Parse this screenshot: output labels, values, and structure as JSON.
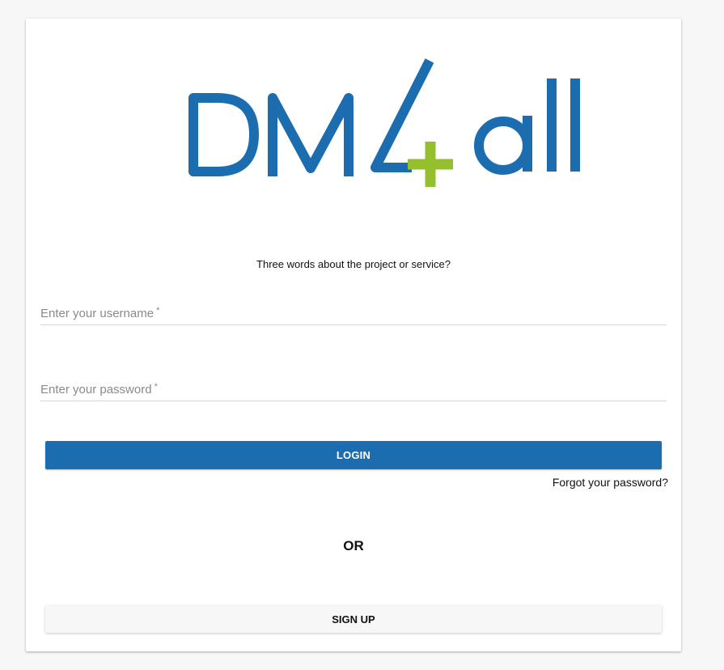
{
  "brand": {
    "logo_icon": "dm4all-logo",
    "primary_color": "#1b6db0",
    "accent_color": "#93c02c"
  },
  "tagline": "Three words about the project or service?",
  "username": {
    "placeholder": "Enter your username",
    "required_mark": "*",
    "value": ""
  },
  "password": {
    "placeholder": "Enter your password",
    "required_mark": "*",
    "value": ""
  },
  "login_button": "LOGIN",
  "forgot_link": "Forgot your password?",
  "separator": "OR",
  "signup_button": "SIGN UP"
}
